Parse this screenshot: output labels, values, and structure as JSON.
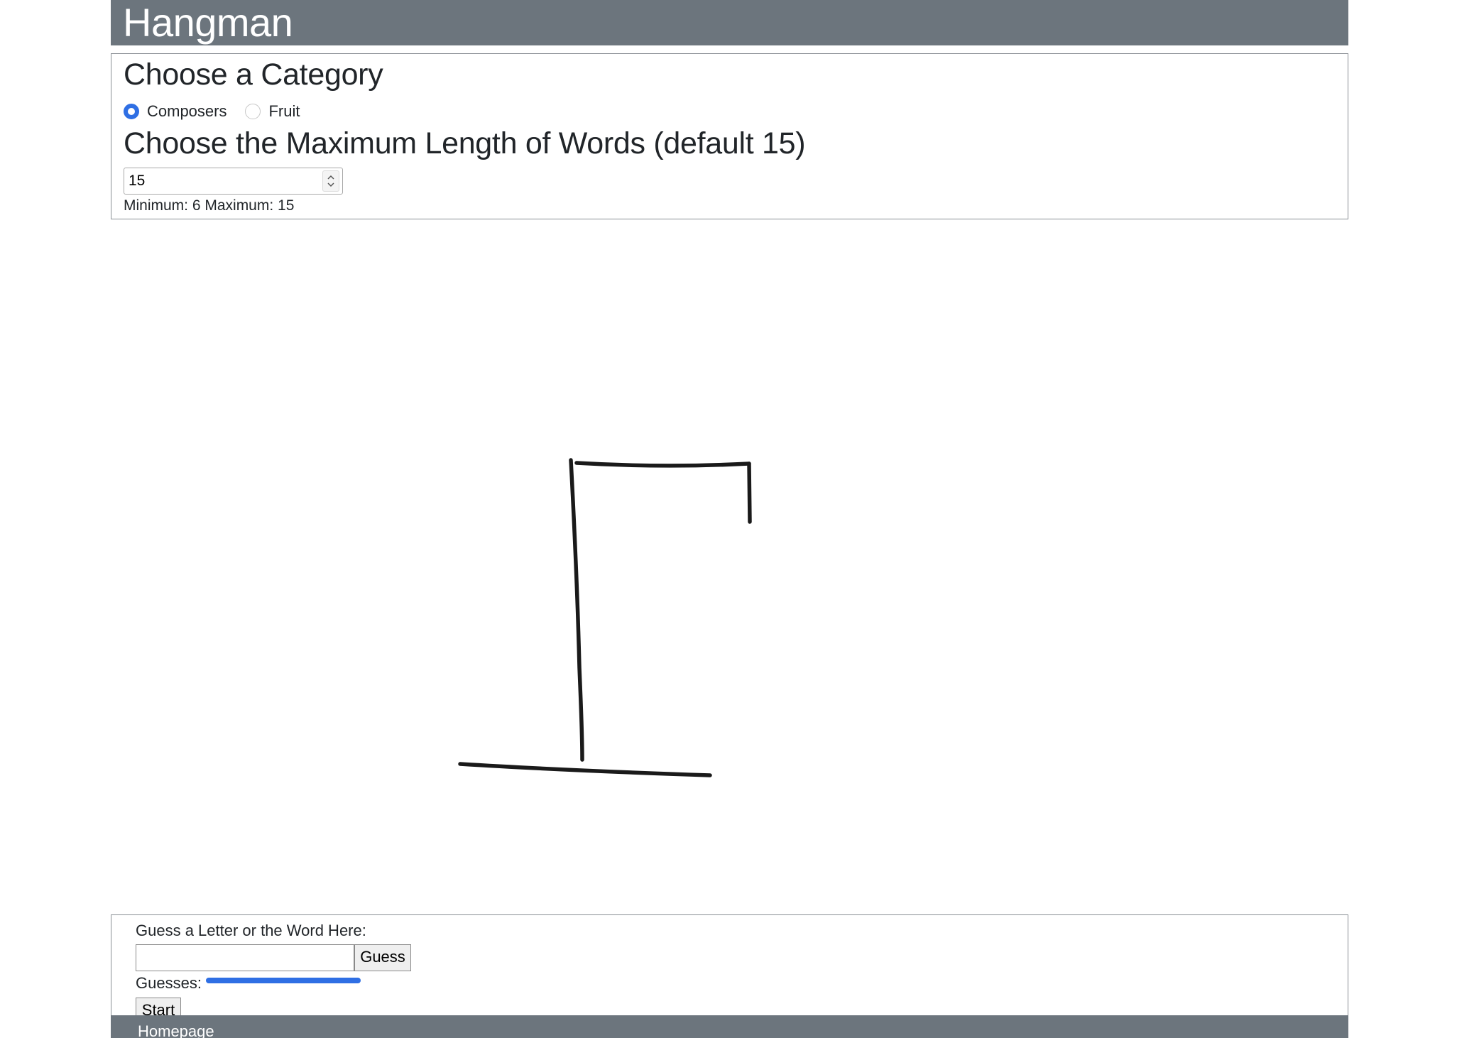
{
  "header": {
    "title": "Hangman"
  },
  "settings": {
    "category_heading": "Choose a Category",
    "categories": [
      {
        "label": "Composers",
        "checked": true
      },
      {
        "label": "Fruit",
        "checked": false
      }
    ],
    "length_heading": "Choose the Maximum Length of Words (default 15)",
    "max_length_value": "15",
    "range_hint": "Minimum: 6 Maximum: 15"
  },
  "game": {
    "guess_label": "Guess a Letter or the Word Here:",
    "guess_input_value": "",
    "guess_button_label": "Guess",
    "guesses_label": "Guesses:",
    "start_button_label": "Start"
  },
  "footer": {
    "homepage_link": "Homepage"
  },
  "colors": {
    "header_bg": "#6c757d",
    "accent": "#2f6fe4",
    "stroke": "#1a1a1a"
  }
}
